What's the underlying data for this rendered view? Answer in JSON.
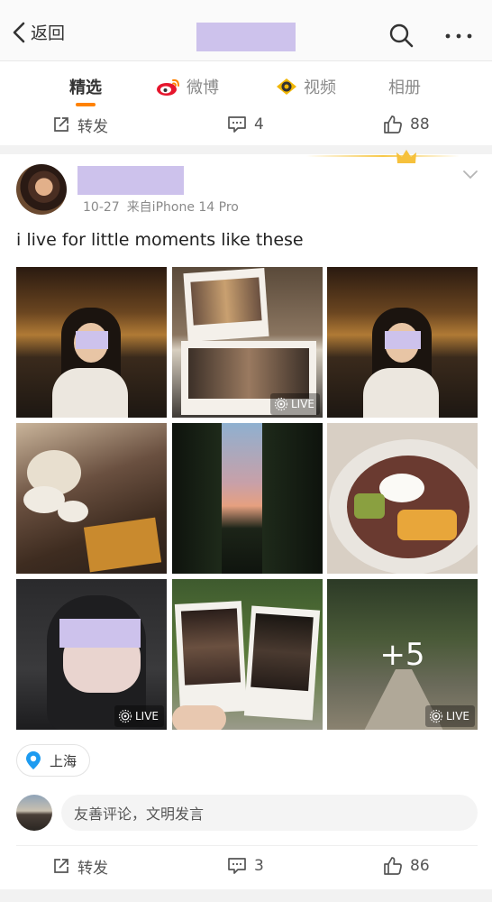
{
  "nav": {
    "back_label": "返回"
  },
  "tabs": [
    {
      "label": "精选",
      "active": true
    },
    {
      "label": "微博",
      "icon": "weibo-icon"
    },
    {
      "label": "视频",
      "icon": "video-icon"
    },
    {
      "label": "相册"
    }
  ],
  "prev_post_actions": {
    "repost_label": "转发",
    "comments": "4",
    "likes": "88"
  },
  "post": {
    "date": "10-27",
    "source": "来自iPhone 14 Pro",
    "text": "i live for little moments like these",
    "live_badge": "LIVE",
    "more_count": "+5",
    "location": "上海"
  },
  "comment_box": {
    "placeholder": "友善评论，文明发言"
  },
  "post_actions": {
    "repost_label": "转发",
    "comments": "3",
    "likes": "86"
  },
  "colors": {
    "accent": "#ff8200",
    "redaction": "#cdc2ec",
    "location_pin": "#1d9bf0"
  }
}
